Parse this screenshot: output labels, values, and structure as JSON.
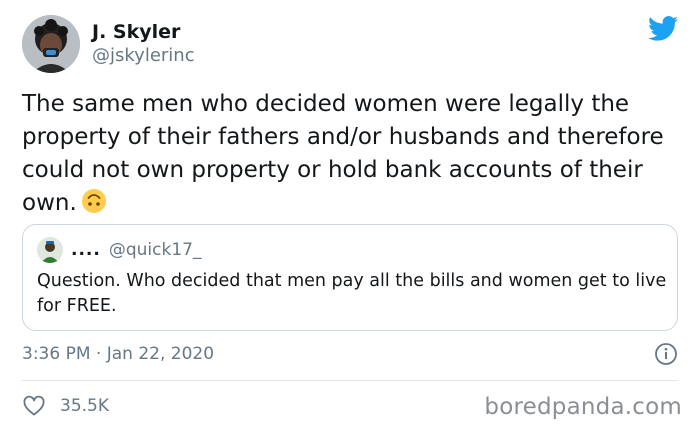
{
  "author": {
    "display_name": "J. Skyler",
    "handle": "@jskylerinc",
    "avatar_icon": "profile-photo"
  },
  "tweet": {
    "text": "The same men who decided women were legally the property of their fathers and/or husbands and therefore could not own property or hold bank accounts of their own.",
    "emoji": "upside-down-face-emoji",
    "timestamp": "3:36 PM · Jan 22, 2020",
    "like_count": "35.5K"
  },
  "quoted_tweet": {
    "display_name": "....",
    "handle": "@quick17_",
    "text": "Question. Who decided that men pay all the bills and women get to live for FREE."
  },
  "watermark": "boredpanda.com",
  "colors": {
    "twitter_blue": "#1da1f2",
    "text": "#14171a",
    "muted": "#657786",
    "border": "#ccd6dd"
  }
}
